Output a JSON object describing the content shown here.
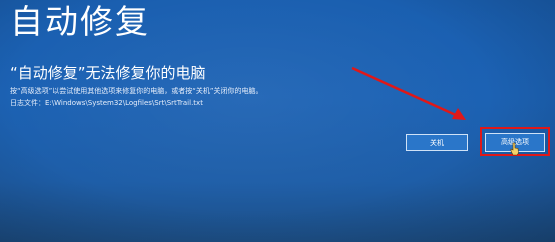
{
  "page": {
    "title": "自动修复"
  },
  "message": {
    "heading": "“自动修复”无法修复你的电脑",
    "instruction": "按“高级选项”以尝试使用其他选项来修复你的电脑，或者按“关机”关闭你的电脑。",
    "log_file": "日志文件：E:\\Windows\\System32\\Logfiles\\Srt\\SrtTrail.txt"
  },
  "buttons": {
    "shutdown_label": "关机",
    "advanced_label": "高级选项"
  },
  "colors": {
    "background": "#1c62b4",
    "annotation": "#e01818"
  },
  "annotations": {
    "arrow_icon": "red-arrow",
    "highlight": "red-rectangle"
  }
}
